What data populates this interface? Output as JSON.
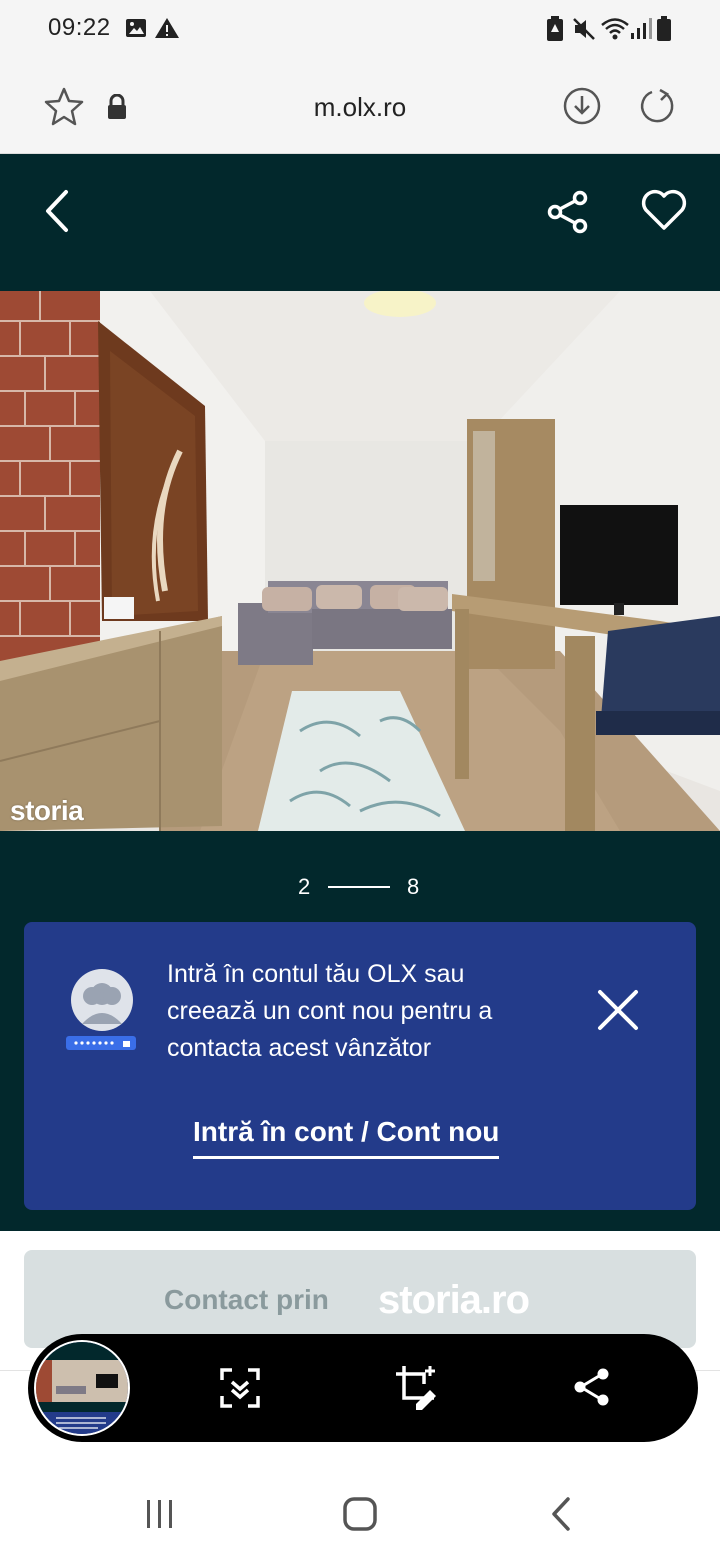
{
  "status_bar": {
    "time": "09:22"
  },
  "browser": {
    "url": "m.olx.ro"
  },
  "gallery": {
    "current": "2",
    "total": "8",
    "watermark": "storia"
  },
  "login_prompt": {
    "message": "Intră în contul tău OLX sau creează un cont nou pentru a contacta acest vânzător",
    "cta": "Intră în cont / Cont nou"
  },
  "contact": {
    "label": "Contact prin",
    "logo": "storia.ro"
  },
  "colors": {
    "header_bg": "#02282c",
    "card_bg": "#233b8a",
    "contact_bg": "#d8dfe0"
  }
}
